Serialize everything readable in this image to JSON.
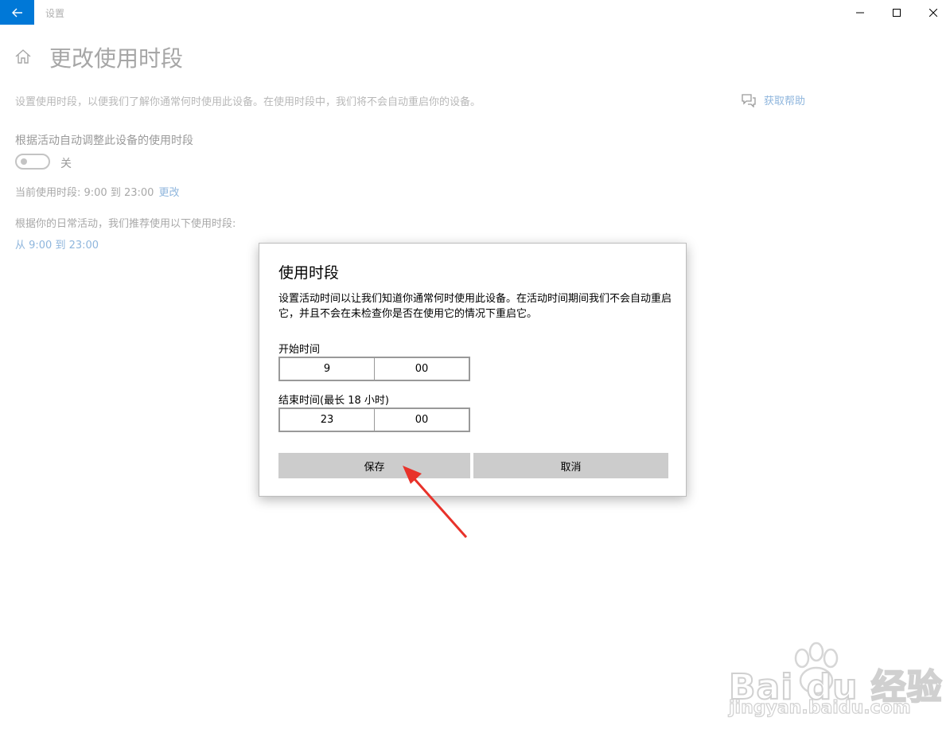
{
  "window": {
    "title": "设置"
  },
  "page": {
    "title": "更改使用时段",
    "description": "设置使用时段，以便我们了解你通常何时使用此设备。在使用时段中，我们将不会自动重启你的设备。",
    "help_link": "获取帮助",
    "auto_adjust_label": "根据活动自动调整此设备的使用时段",
    "toggle_state": "关",
    "current_hours": "当前使用时段: 9:00 到 23:00",
    "change_link": "更改",
    "recommend_label": "根据你的日常活动，我们推荐使用以下使用时段:",
    "recommend_link": "从 9:00 到 23:00"
  },
  "dialog": {
    "title": "使用时段",
    "description": "设置活动时间以让我们知道你通常何时使用此设备。在活动时间期间我们不会自动重启它，并且不会在未检查你是否在使用它的情况下重启它。",
    "start_label": "开始时间",
    "start_hour": "9",
    "start_minute": "00",
    "end_label": "结束时间(最长 18 小时)",
    "end_hour": "23",
    "end_minute": "00",
    "save_label": "保存",
    "cancel_label": "取消"
  },
  "watermark": {
    "brand": "Bai du 经验",
    "url": "jingyan.baidu.com"
  },
  "colors": {
    "accent": "#0078d7",
    "arrow": "#e8322a",
    "link": "#8fb6dd"
  }
}
